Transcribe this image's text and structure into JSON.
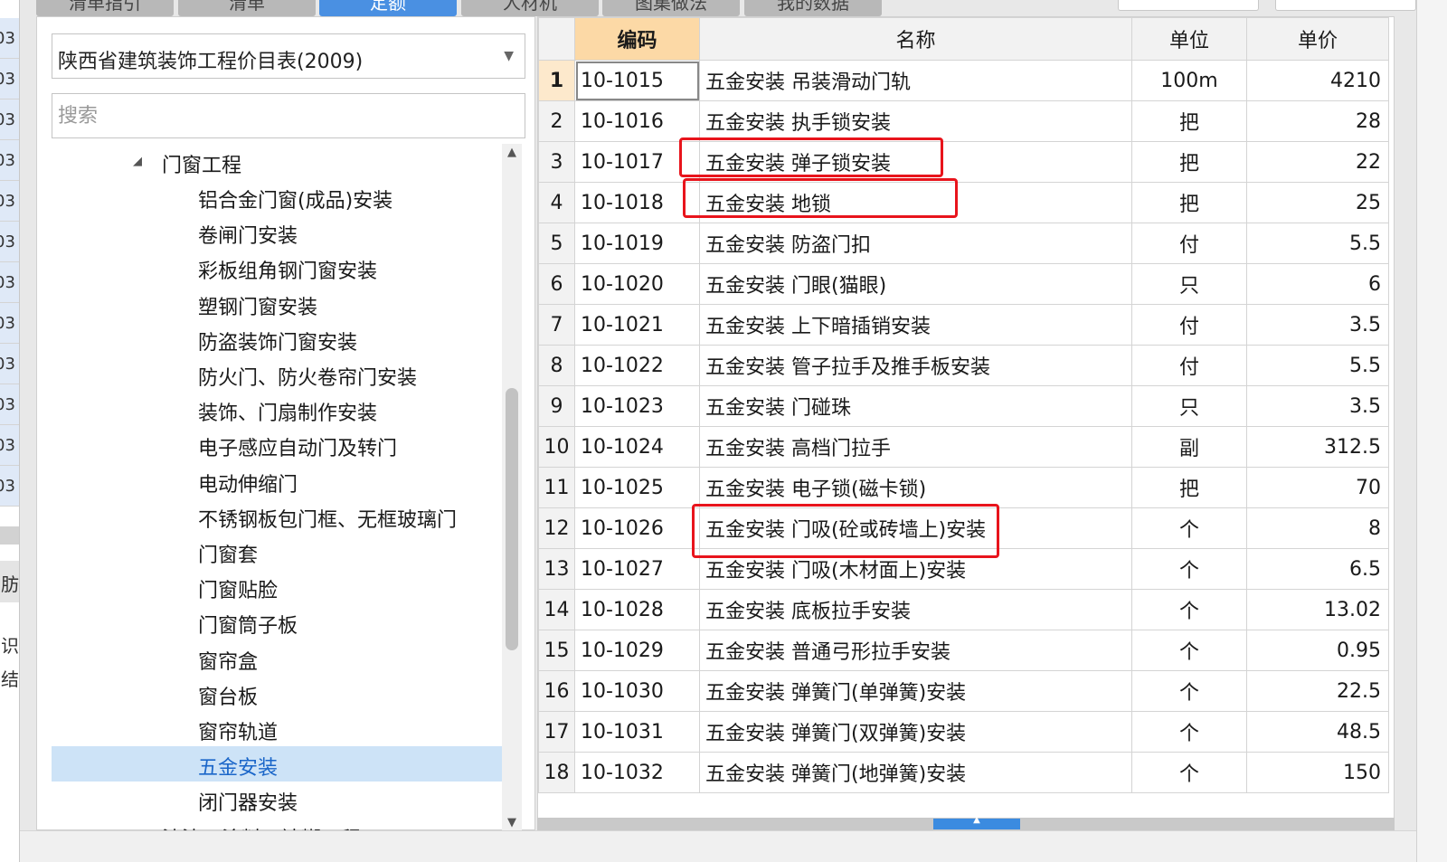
{
  "left_strip": {
    "row_prefix": "03",
    "cells": 12,
    "labels": [
      "肪",
      "识",
      "结"
    ]
  },
  "tabs": [
    {
      "label": "清单指引",
      "active": false
    },
    {
      "label": "清单",
      "active": false
    },
    {
      "label": "定额",
      "active": true
    },
    {
      "label": "人材机",
      "active": false
    },
    {
      "label": "图集做法",
      "active": false
    },
    {
      "label": "我的数据",
      "active": false
    }
  ],
  "library": {
    "selected": "陕西省建筑装饰工程价目表(2009)",
    "arrow_icon": "chevron-down-icon"
  },
  "search": {
    "placeholder": "搜索",
    "value": ""
  },
  "tree": {
    "parent": "门窗工程",
    "items": [
      "铝合金门窗(成品)安装",
      "卷闸门安装",
      "彩板组角钢门窗安装",
      "塑钢门窗安装",
      "防盗装饰门窗安装",
      "防火门、防火卷帘门安装",
      "装饰、门扇制作安装",
      "电子感应自动门及转门",
      "电动伸缩门",
      "不锈钢板包门框、无框玻璃门",
      "门窗套",
      "门窗贴脸",
      "门窗筒子板",
      "窗帘盒",
      "窗台板",
      "窗帘轨道",
      "五金安装",
      "闭门器安装"
    ],
    "selected": "五金安装",
    "clipped_next": "油漆、涂料、裱糊工程"
  },
  "grid": {
    "columns": {
      "code": "编码",
      "name": "名称",
      "unit": "单位",
      "price": "单价"
    },
    "rows": [
      {
        "no": "1",
        "code": "10-1015",
        "name": "五金安装 吊装滑动门轨",
        "unit": "100m",
        "price": "4210"
      },
      {
        "no": "2",
        "code": "10-1016",
        "name": "五金安装 执手锁安装",
        "unit": "把",
        "price": "28"
      },
      {
        "no": "3",
        "code": "10-1017",
        "name": "五金安装 弹子锁安装",
        "unit": "把",
        "price": "22"
      },
      {
        "no": "4",
        "code": "10-1018",
        "name": "五金安装 地锁",
        "unit": "把",
        "price": "25"
      },
      {
        "no": "5",
        "code": "10-1019",
        "name": "五金安装 防盗门扣",
        "unit": "付",
        "price": "5.5"
      },
      {
        "no": "6",
        "code": "10-1020",
        "name": "五金安装 门眼(猫眼)",
        "unit": "只",
        "price": "6"
      },
      {
        "no": "7",
        "code": "10-1021",
        "name": "五金安装 上下暗插销安装",
        "unit": "付",
        "price": "3.5"
      },
      {
        "no": "8",
        "code": "10-1022",
        "name": "五金安装 管子拉手及推手板安装",
        "unit": "付",
        "price": "5.5"
      },
      {
        "no": "9",
        "code": "10-1023",
        "name": "五金安装 门碰珠",
        "unit": "只",
        "price": "3.5"
      },
      {
        "no": "10",
        "code": "10-1024",
        "name": "五金安装 高档门拉手",
        "unit": "副",
        "price": "312.5"
      },
      {
        "no": "11",
        "code": "10-1025",
        "name": "五金安装 电子锁(磁卡锁)",
        "unit": "把",
        "price": "70"
      },
      {
        "no": "12",
        "code": "10-1026",
        "name": "五金安装 门吸(砼或砖墙上)安装",
        "unit": "个",
        "price": "8"
      },
      {
        "no": "13",
        "code": "10-1027",
        "name": "五金安装 门吸(木材面上)安装",
        "unit": "个",
        "price": "6.5"
      },
      {
        "no": "14",
        "code": "10-1028",
        "name": "五金安装 底板拉手安装",
        "unit": "个",
        "price": "13.02"
      },
      {
        "no": "15",
        "code": "10-1029",
        "name": "五金安装 普通弓形拉手安装",
        "unit": "个",
        "price": "0.95"
      },
      {
        "no": "16",
        "code": "10-1030",
        "name": "五金安装 弹簧门(单弹簧)安装",
        "unit": "个",
        "price": "22.5"
      },
      {
        "no": "17",
        "code": "10-1031",
        "name": "五金安装 弹簧门(双弹簧)安装",
        "unit": "个",
        "price": "48.5"
      },
      {
        "no": "18",
        "code": "10-1032",
        "name": "五金安装 弹簧门(地弹簧)安装",
        "unit": "个",
        "price": "150"
      }
    ],
    "highlighted_rows": [
      "2",
      "3",
      "11"
    ],
    "highlight_color": "#e8141c",
    "sorted_column_color": "#fcd9a6",
    "selected_tree_color": "#cde3f7"
  }
}
